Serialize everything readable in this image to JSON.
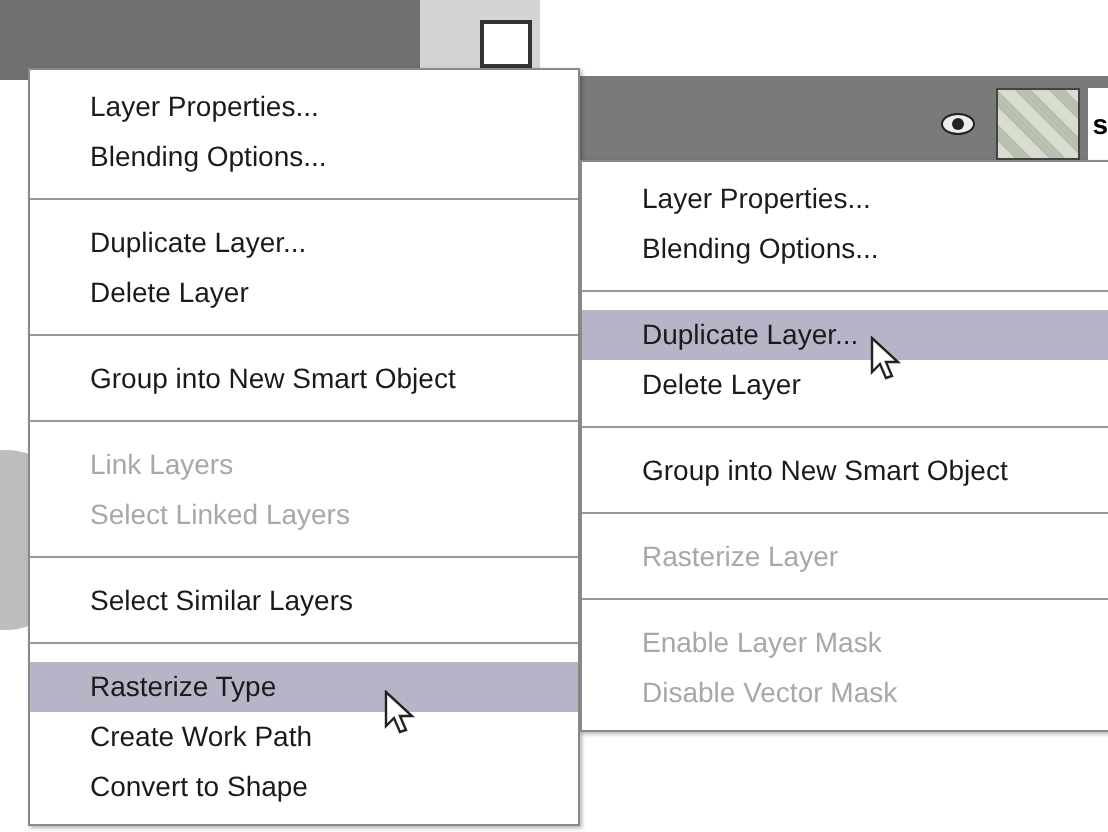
{
  "layers_panel": {
    "layer_label": "s"
  },
  "menus": [
    {
      "items": [
        {
          "kind": "item",
          "label": "Layer Properties...",
          "disabled": false,
          "selected": false
        },
        {
          "kind": "item",
          "label": "Blending Options...",
          "disabled": false,
          "selected": false
        },
        {
          "kind": "separator"
        },
        {
          "kind": "item",
          "label": "Duplicate Layer...",
          "disabled": false,
          "selected": false
        },
        {
          "kind": "item",
          "label": "Delete Layer",
          "disabled": false,
          "selected": false
        },
        {
          "kind": "separator"
        },
        {
          "kind": "item",
          "label": "Group into New Smart Object",
          "disabled": false,
          "selected": false
        },
        {
          "kind": "separator"
        },
        {
          "kind": "item",
          "label": "Link Layers",
          "disabled": true,
          "selected": false
        },
        {
          "kind": "item",
          "label": "Select Linked Layers",
          "disabled": true,
          "selected": false
        },
        {
          "kind": "separator"
        },
        {
          "kind": "item",
          "label": "Select Similar Layers",
          "disabled": false,
          "selected": false
        },
        {
          "kind": "separator"
        },
        {
          "kind": "item",
          "label": "Rasterize Type",
          "disabled": false,
          "selected": true
        },
        {
          "kind": "item",
          "label": "Create Work Path",
          "disabled": false,
          "selected": false
        },
        {
          "kind": "item",
          "label": "Convert to Shape",
          "disabled": false,
          "selected": false
        }
      ]
    },
    {
      "items": [
        {
          "kind": "item",
          "label": "Layer Properties...",
          "disabled": false,
          "selected": false
        },
        {
          "kind": "item",
          "label": "Blending Options...",
          "disabled": false,
          "selected": false
        },
        {
          "kind": "separator"
        },
        {
          "kind": "item",
          "label": "Duplicate Layer...",
          "disabled": false,
          "selected": true
        },
        {
          "kind": "item",
          "label": "Delete Layer",
          "disabled": false,
          "selected": false
        },
        {
          "kind": "separator"
        },
        {
          "kind": "item",
          "label": "Group into New Smart Object",
          "disabled": false,
          "selected": false
        },
        {
          "kind": "separator"
        },
        {
          "kind": "item",
          "label": "Rasterize Layer",
          "disabled": true,
          "selected": false
        },
        {
          "kind": "separator"
        },
        {
          "kind": "item",
          "label": "Enable Layer Mask",
          "disabled": true,
          "selected": false
        },
        {
          "kind": "item",
          "label": "Disable Vector Mask",
          "disabled": true,
          "selected": false
        }
      ]
    }
  ]
}
